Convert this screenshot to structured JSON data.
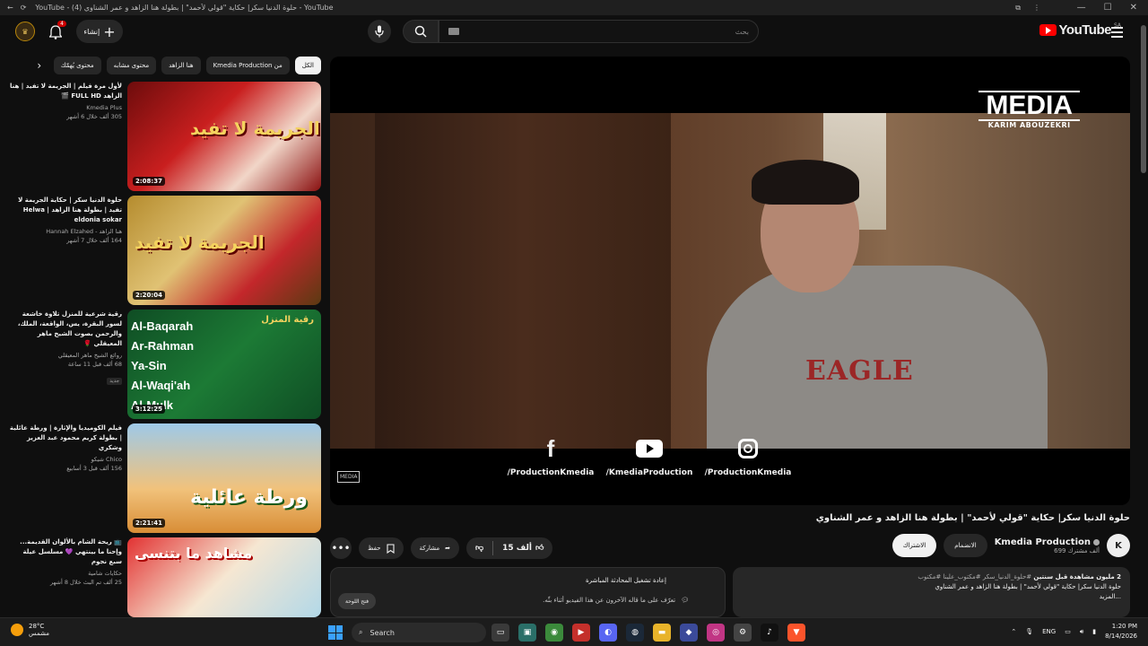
{
  "browser": {
    "title": "YouTube - (4) حلوة الدنيا سكر| حكاية \"قولي لأحمد\" | بطولة هنا الزاهد و عمر الشناوي - YouTube"
  },
  "masthead": {
    "logo_text": "YouTube",
    "country": "SA",
    "search_placeholder": "بحث",
    "create_label": "إنشاء",
    "notifications_count": "4"
  },
  "player": {
    "watermark_title": "MEDIA",
    "watermark_name": "KARIM ABOUZEKRI",
    "small_watermark": "MEDIA",
    "overlay_text": "EAGLE",
    "socials": [
      {
        "icon": "facebook-icon",
        "handle": "/ProductionKmedia"
      },
      {
        "icon": "youtube-icon",
        "handle": "/KmediaProduction"
      },
      {
        "icon": "instagram-icon",
        "handle": "/ProductionKmedia"
      }
    ]
  },
  "video": {
    "title": "حلوة الدنيا سكر| حكاية \"قولي لأحمد\" | بطولة هنا الزاهد و عمر الشناوي",
    "channel": "Kmedia Production",
    "subscribers": "699 ألف مشترك",
    "join_label": "الانضمام",
    "subscribe_label": "الاشتراك",
    "likes": "15 ألف",
    "share_label": "مشاركة",
    "save_label": "حفظ",
    "more_label": "•••",
    "description": {
      "stats": "2 مليون مشاهدة  قبل سنتين",
      "tags": "#حلوة_الدنيا_سكر #مكتوب_علينا #مكتوب",
      "text": "حلوة الدنيا سكر| حكاية \"قولي لأحمد\" | بطولة هنا الزاهد و عمر الشناوي",
      "more": "...المزيد"
    }
  },
  "chat": {
    "title": "إعادة تشغيل المحادثة المباشرة",
    "description": "تعرّف على ما قاله الآخرون عن هذا الفيديو أثناء بثّه.",
    "open_label": "فتح اللوحة"
  },
  "chips": [
    {
      "label": "الكل",
      "active": true
    },
    {
      "label": "من Kmedia Production",
      "active": false
    },
    {
      "label": "هنا الزاهد",
      "active": false
    },
    {
      "label": "محتوى مشابه",
      "active": false
    },
    {
      "label": "محتوى يُهمّك",
      "active": false
    }
  ],
  "related": [
    {
      "title": "لأول مرة فيلم | الجريمة لا تفيد | هنا الزاهد FULL HD 🎬",
      "channel": "Kmedia Plus",
      "views": "305 ألف  خلال 6 أشهر",
      "duration": "2:08:37",
      "thumb_text": "الجريمة لا تفيد",
      "badge": ""
    },
    {
      "title": "حلوة الدنيا سكر | حكاية الجريمة لا تفيد | بطولة هنا الزاهد | Helwa eldonia sokar",
      "channel": "هنا الزاهد - Hannah Elzahed",
      "views": "164 ألف  خلال 7 أشهر",
      "duration": "2:20:04",
      "thumb_text": "الجريمة لا تفيد",
      "badge": ""
    },
    {
      "title": "رقية شرعية للمنزل   تلاوة خاشعة لسور البقرة، يس، الواقعة، الملك، والرحمن بصوت الشيخ ماهر المعيقلي 🌹",
      "channel": "روائع الشيخ ماهر المعيقلي",
      "views": "68 ألف  قبل 11 ساعة",
      "duration": "3:12:25",
      "thumb_text": "رقية المنزل",
      "badge": "جديد",
      "surahs": [
        "Al-Baqarah",
        "Ar-Rahman",
        "Ya-Sin",
        "Al-Waqi'ah",
        "Al-Mulk"
      ]
    },
    {
      "title": "فيلم الكوميديا والإثارة | ورطة عائلية | بطولة كريم محمود عبد العزيز وشكري",
      "channel": "Chico شيكو",
      "views": "156 ألف  قبل 3 أسابيع",
      "duration": "2:21:41",
      "thumb_text": "ورطة عائلية",
      "badge": ""
    },
    {
      "title": "📺 ريحة الشام بالألوان القديمة... وإحنا ما بينتهي 💜 مسلسل عيلة سبع نجوم",
      "channel": "حكايات شامية",
      "views": "25 ألف  تم البث خلال 8 أشهر",
      "duration": "",
      "thumb_text": "مشاهد ما بتنسى",
      "badge": ""
    }
  ],
  "taskbar": {
    "weather_temp": "28°C",
    "weather_desc": "مشمس",
    "search_label": "Search",
    "lang": "ENG",
    "time": "1:20 PM",
    "date": "8/14/2026"
  }
}
